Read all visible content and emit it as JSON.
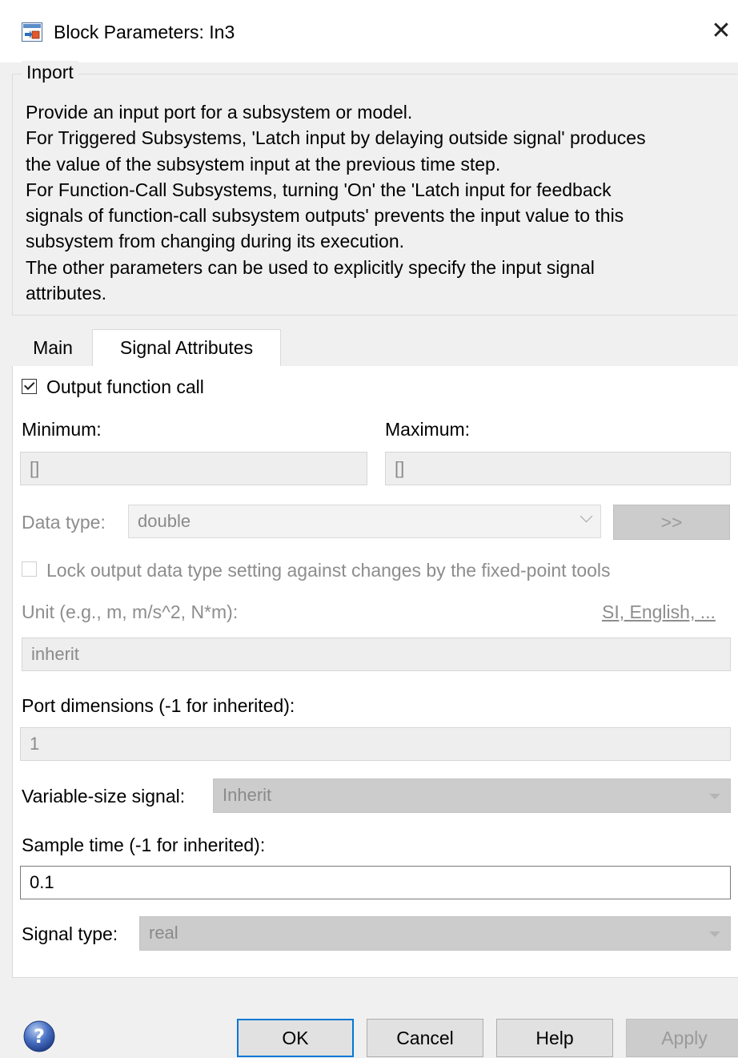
{
  "window": {
    "title": "Block Parameters: In3",
    "close_glyph": "✕"
  },
  "group": {
    "legend": "Inport",
    "description_lines": [
      "Provide an input port for a subsystem or model.",
      "For Triggered Subsystems, 'Latch input by delaying outside signal' produces",
      "the value of the subsystem input at the previous time step.",
      "For Function-Call Subsystems, turning 'On' the 'Latch input for feedback",
      "signals of function-call subsystem outputs' prevents the input value to this",
      "subsystem from changing during its execution.",
      "The other parameters can be used to explicitly specify the input signal",
      "attributes."
    ]
  },
  "tabs": {
    "main": "Main",
    "signal_attributes": "Signal Attributes",
    "selected": "Signal Attributes"
  },
  "signal": {
    "output_function_call": {
      "label": "Output function call",
      "checked": true
    },
    "minimum": {
      "label": "Minimum:",
      "value": "[]"
    },
    "maximum": {
      "label": "Maximum:",
      "value": "[]"
    },
    "data_type": {
      "label": "Data type:",
      "value": "double",
      "assistant_button": ">>"
    },
    "lock_output": {
      "label": "Lock output data type setting against changes by the fixed-point tools",
      "checked": false
    },
    "unit": {
      "label": "Unit (e.g., m, m/s^2, N*m):",
      "link": "SI, English, ...",
      "value": "inherit"
    },
    "port_dimensions": {
      "label": "Port dimensions (-1 for inherited):",
      "value": "1"
    },
    "variable_size": {
      "label": "Variable-size signal:",
      "value": "Inherit"
    },
    "sample_time": {
      "label": "Sample time (-1 for inherited):",
      "value": "0.1"
    },
    "signal_type": {
      "label": "Signal type:",
      "value": "real"
    }
  },
  "buttons": {
    "ok": "OK",
    "cancel": "Cancel",
    "help": "Help",
    "apply": "Apply"
  },
  "colors": {
    "accent": "#0078d7",
    "dialog_bg": "#f0f0f0",
    "panel_bg": "#ffffff",
    "disabled_text": "#8d8d8d"
  }
}
